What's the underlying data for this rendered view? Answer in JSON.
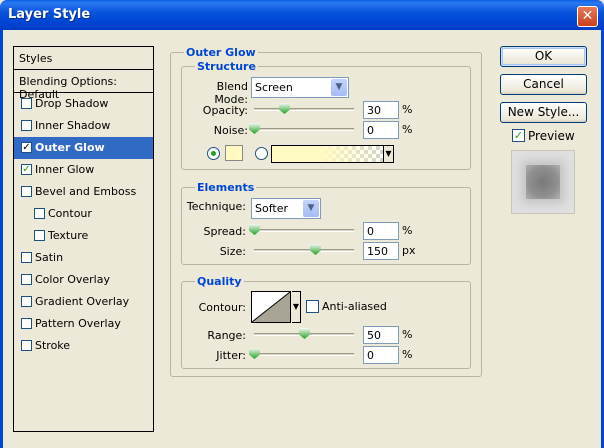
{
  "window": {
    "title": "Layer Style",
    "close_label": "✕"
  },
  "styles": {
    "header": "Styles",
    "blending": "Blending Options: Default",
    "items": [
      {
        "label": "Drop Shadow",
        "checked": false,
        "indent": false,
        "selected": false
      },
      {
        "label": "Inner Shadow",
        "checked": false,
        "indent": false,
        "selected": false
      },
      {
        "label": "Outer Glow",
        "checked": true,
        "indent": false,
        "selected": true
      },
      {
        "label": "Inner Glow",
        "checked": true,
        "indent": false,
        "selected": false
      },
      {
        "label": "Bevel and Emboss",
        "checked": false,
        "indent": false,
        "selected": false
      },
      {
        "label": "Contour",
        "checked": false,
        "indent": true,
        "selected": false
      },
      {
        "label": "Texture",
        "checked": false,
        "indent": true,
        "selected": false
      },
      {
        "label": "Satin",
        "checked": false,
        "indent": false,
        "selected": false
      },
      {
        "label": "Color Overlay",
        "checked": false,
        "indent": false,
        "selected": false
      },
      {
        "label": "Gradient Overlay",
        "checked": false,
        "indent": false,
        "selected": false
      },
      {
        "label": "Pattern Overlay",
        "checked": false,
        "indent": false,
        "selected": false
      },
      {
        "label": "Stroke",
        "checked": false,
        "indent": false,
        "selected": false
      }
    ]
  },
  "outer_glow": {
    "title": "Outer Glow",
    "structure": {
      "title": "Structure",
      "blend_mode_label": "Blend Mode:",
      "blend_mode_value": "Screen",
      "opacity_label": "Opacity:",
      "opacity_value": "30",
      "opacity_unit": "%",
      "noise_label": "Noise:",
      "noise_value": "0",
      "noise_unit": "%",
      "glow_color": "#fffac2"
    },
    "elements": {
      "title": "Elements",
      "technique_label": "Technique:",
      "technique_value": "Softer",
      "spread_label": "Spread:",
      "spread_value": "0",
      "spread_unit": "%",
      "size_label": "Size:",
      "size_value": "150",
      "size_unit": "px"
    },
    "quality": {
      "title": "Quality",
      "contour_label": "Contour:",
      "antialiased_label": "Anti-aliased",
      "range_label": "Range:",
      "range_value": "50",
      "range_unit": "%",
      "jitter_label": "Jitter:",
      "jitter_value": "0",
      "jitter_unit": "%"
    }
  },
  "buttons": {
    "ok": "OK",
    "cancel": "Cancel",
    "new_style": "New Style...",
    "preview_label": "Preview",
    "preview_checked": true
  },
  "colors": {
    "title_bar": "#0046d5",
    "selection": "#316ac5",
    "group_title": "#0046d5",
    "check": "#21a121"
  }
}
